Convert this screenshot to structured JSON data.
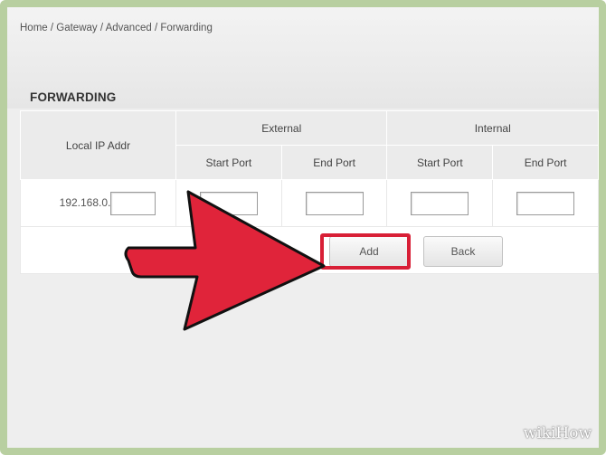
{
  "breadcrumb": "Home / Gateway / Advanced / Forwarding",
  "page_title": "FORWARDING",
  "table": {
    "local_ip_header": "Local IP Addr",
    "external_header": "External",
    "internal_header": "Internal",
    "start_port": "Start Port",
    "end_port": "End Port",
    "ip_prefix": "192.168.0.",
    "ip_value": "",
    "ext_start_value": "",
    "ext_end_value": "",
    "int_start_value": "",
    "int_end_value": ""
  },
  "buttons": {
    "add": "Add",
    "back": "Back"
  },
  "overlay": {
    "arrow_color": "#e0243a",
    "highlight_color": "#d81f36"
  },
  "watermark": "wikiHow"
}
